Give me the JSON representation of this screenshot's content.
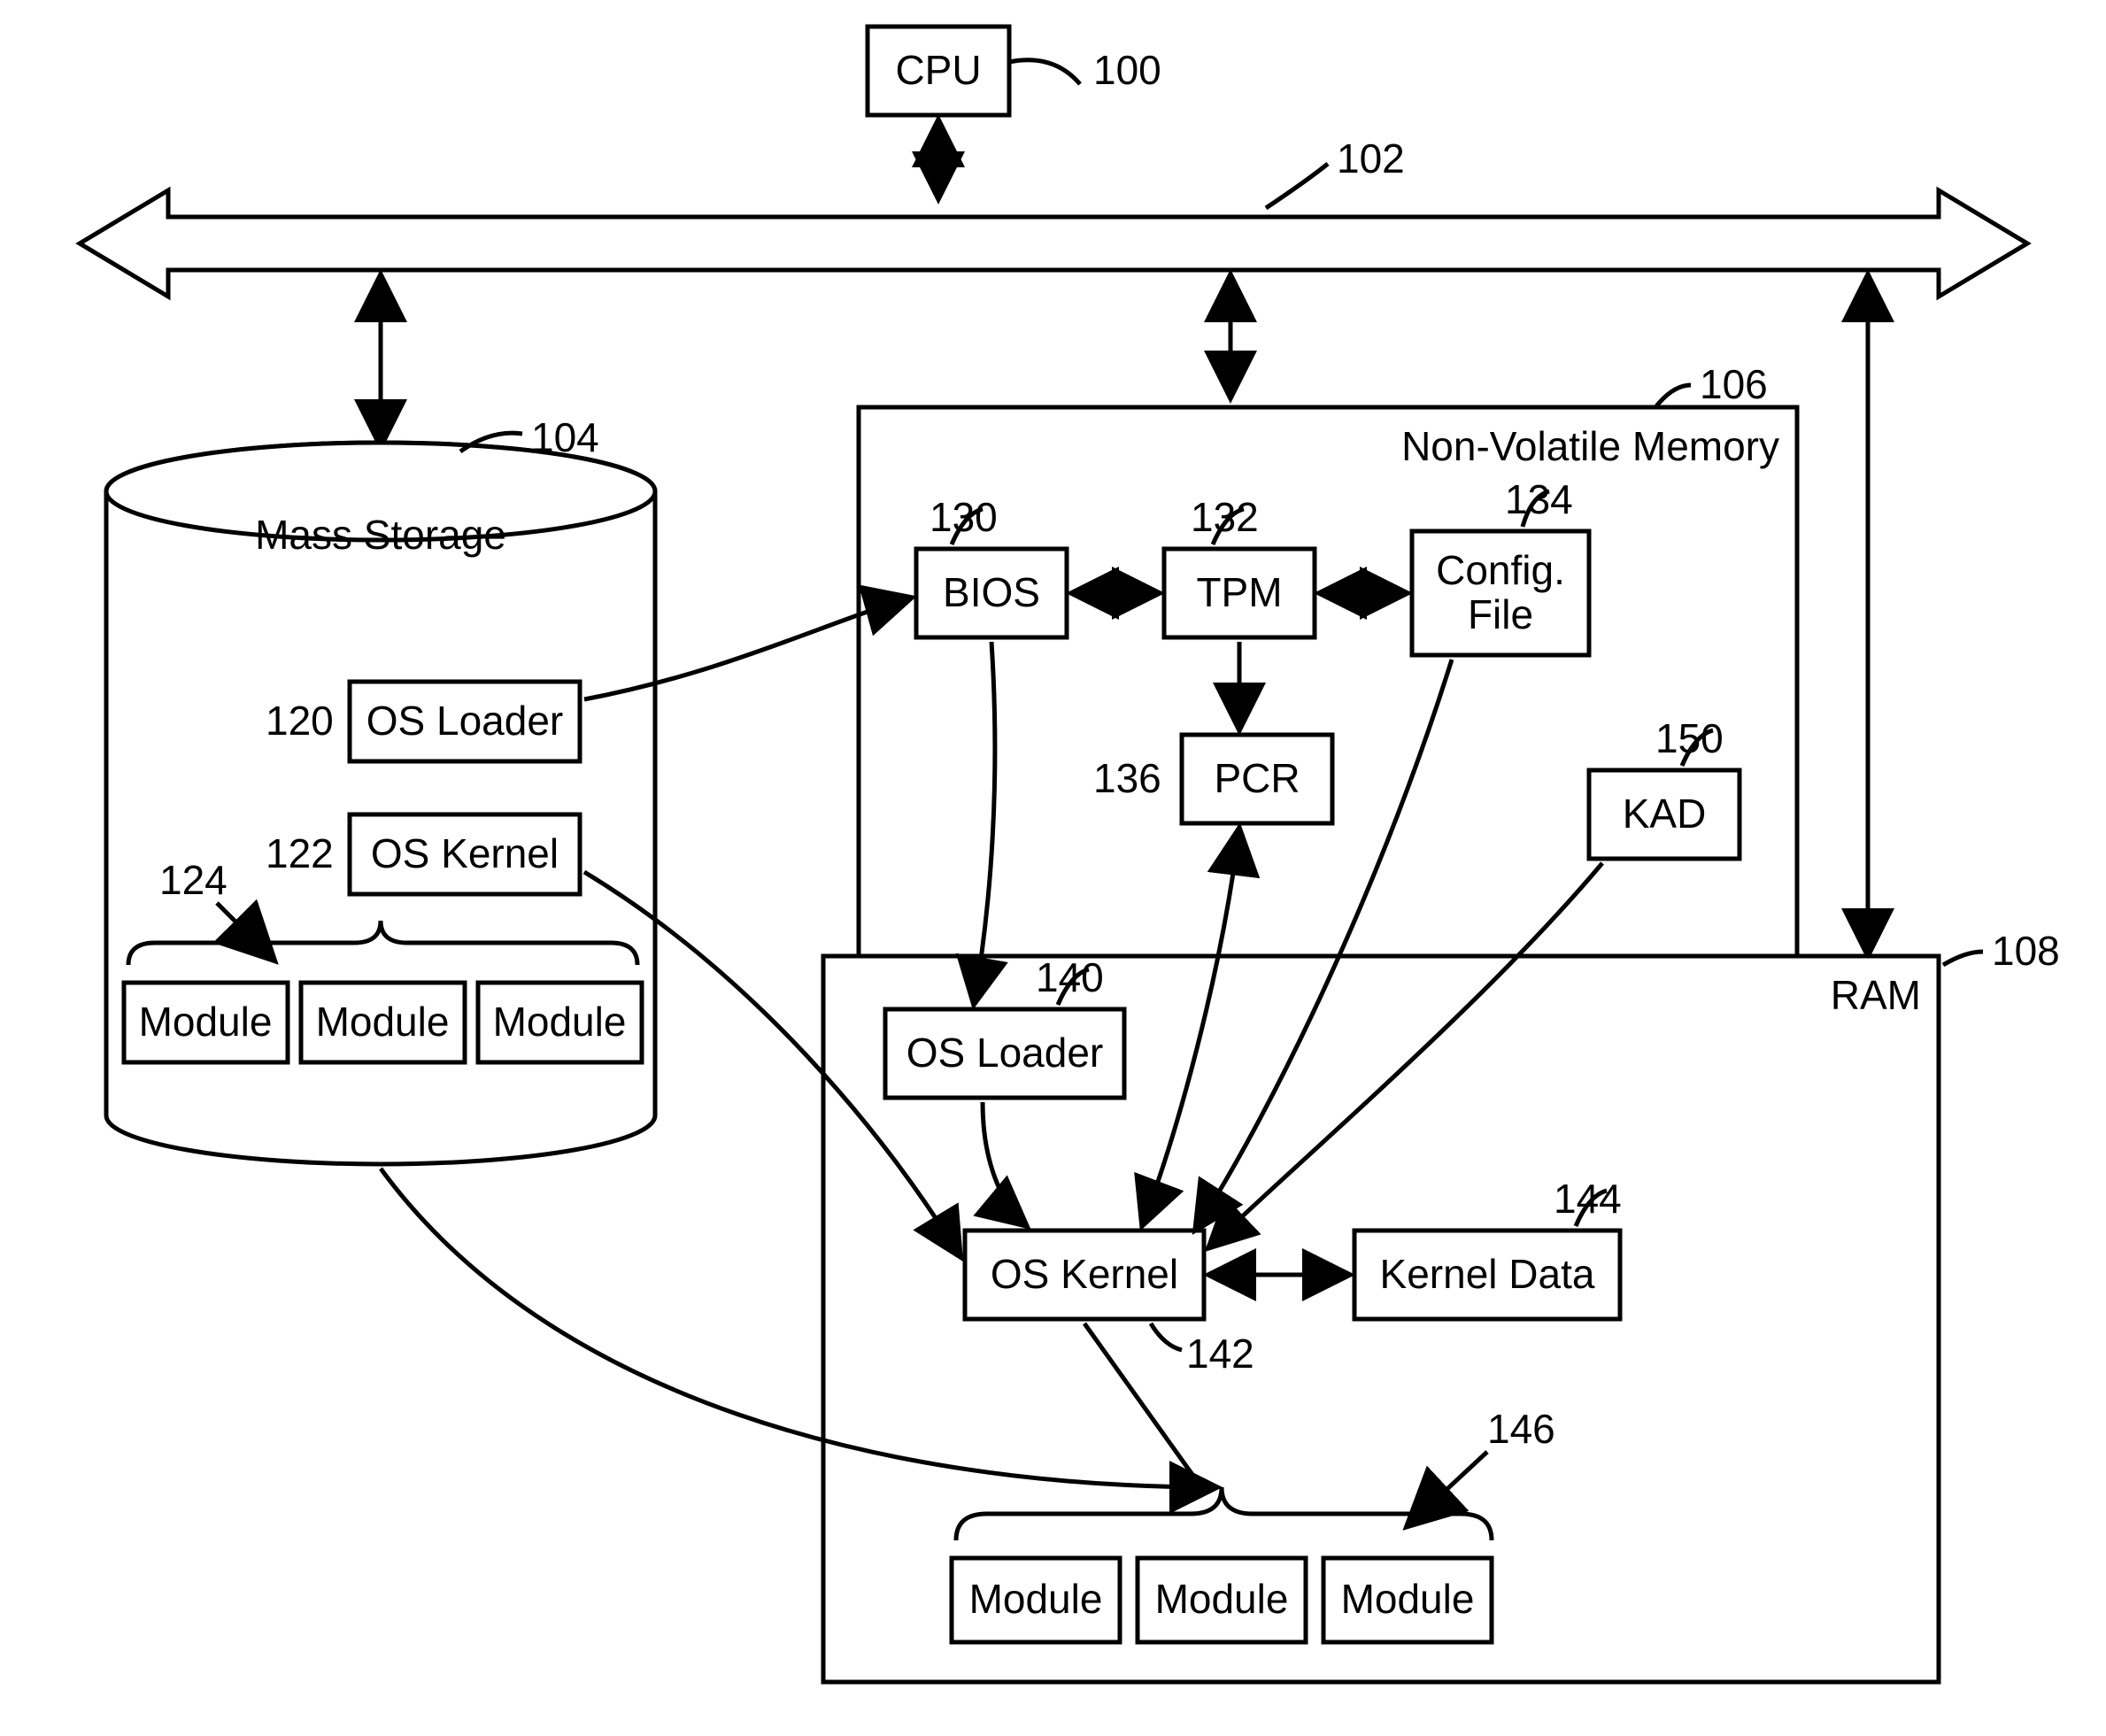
{
  "cpu": {
    "label": "CPU",
    "num": "100"
  },
  "bus": {
    "num": "102"
  },
  "mass": {
    "label": "Mass Storage",
    "num": "104"
  },
  "nvm": {
    "label": "Non-Volatile Memory",
    "num": "106"
  },
  "ram": {
    "label": "RAM",
    "num": "108"
  },
  "osloader_ms": {
    "label": "OS Loader",
    "num": "120"
  },
  "oskernel_ms": {
    "label": "OS Kernel",
    "num": "122"
  },
  "modgroup_ms": {
    "num": "124"
  },
  "mod_ms_1": {
    "label": "Module"
  },
  "mod_ms_2": {
    "label": "Module"
  },
  "mod_ms_3": {
    "label": "Module"
  },
  "bios": {
    "label": "BIOS",
    "num": "130"
  },
  "tpm": {
    "label": "TPM",
    "num": "132"
  },
  "config": {
    "label1": "Config.",
    "label2": "File",
    "num": "134"
  },
  "pcr": {
    "label": "PCR",
    "num": "136"
  },
  "kad": {
    "label": "KAD",
    "num": "150"
  },
  "osloader_r": {
    "label": "OS Loader",
    "num": "140"
  },
  "oskernel_r": {
    "label": "OS Kernel",
    "num": "142"
  },
  "kd": {
    "label": "Kernel Data",
    "num": "144"
  },
  "modgroup_r": {
    "num": "146"
  },
  "mod_r_1": {
    "label": "Module"
  },
  "mod_r_2": {
    "label": "Module"
  },
  "mod_r_3": {
    "label": "Module"
  }
}
